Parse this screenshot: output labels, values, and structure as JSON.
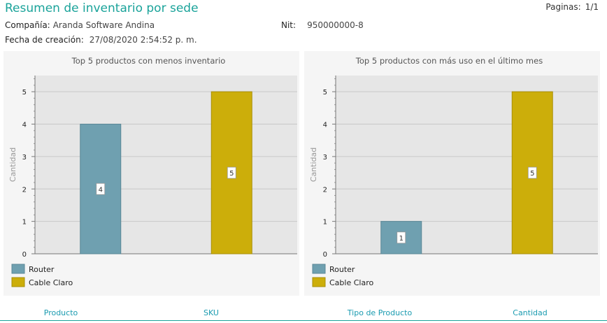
{
  "report": {
    "title": "Resumen de inventario por sede",
    "pages_label": "Paginas:",
    "pages_value": "1/1",
    "company_label": "Compañía:",
    "company_value": "Aranda Software Andina",
    "nit_label": "Nit:",
    "nit_value": "950000000-8",
    "date_label": "Fecha de creación:",
    "date_value": "27/08/2020 2:54:52 p. m."
  },
  "colors": {
    "router": "#6fa0b0",
    "cable_claro": "#ccae0a",
    "accent": "#1aa39a"
  },
  "chart_data": [
    {
      "type": "bar",
      "title": "Top 5 productos con menos inventario",
      "ylabel": "Cantidad",
      "ylim": [
        0,
        5.5
      ],
      "yticks": [
        "0",
        "1",
        "2",
        "3",
        "4",
        "5"
      ],
      "grid": true,
      "legend_position": "bottom-left",
      "series": [
        {
          "name": "Router",
          "value": 4,
          "label": "4"
        },
        {
          "name": "Cable Claro",
          "value": 5,
          "label": "5"
        }
      ]
    },
    {
      "type": "bar",
      "title": "Top 5 productos con más uso en el último mes",
      "ylabel": "Cantidad",
      "ylim": [
        0,
        5.5
      ],
      "yticks": [
        "0",
        "1",
        "2",
        "3",
        "4",
        "5"
      ],
      "grid": true,
      "legend_position": "bottom-left",
      "series": [
        {
          "name": "Router",
          "value": 1,
          "label": "1"
        },
        {
          "name": "Cable Claro",
          "value": 5,
          "label": "5"
        }
      ]
    }
  ],
  "table": {
    "columns": [
      "Producto",
      "SKU",
      "Tipo de Producto",
      "Cantidad"
    ]
  }
}
